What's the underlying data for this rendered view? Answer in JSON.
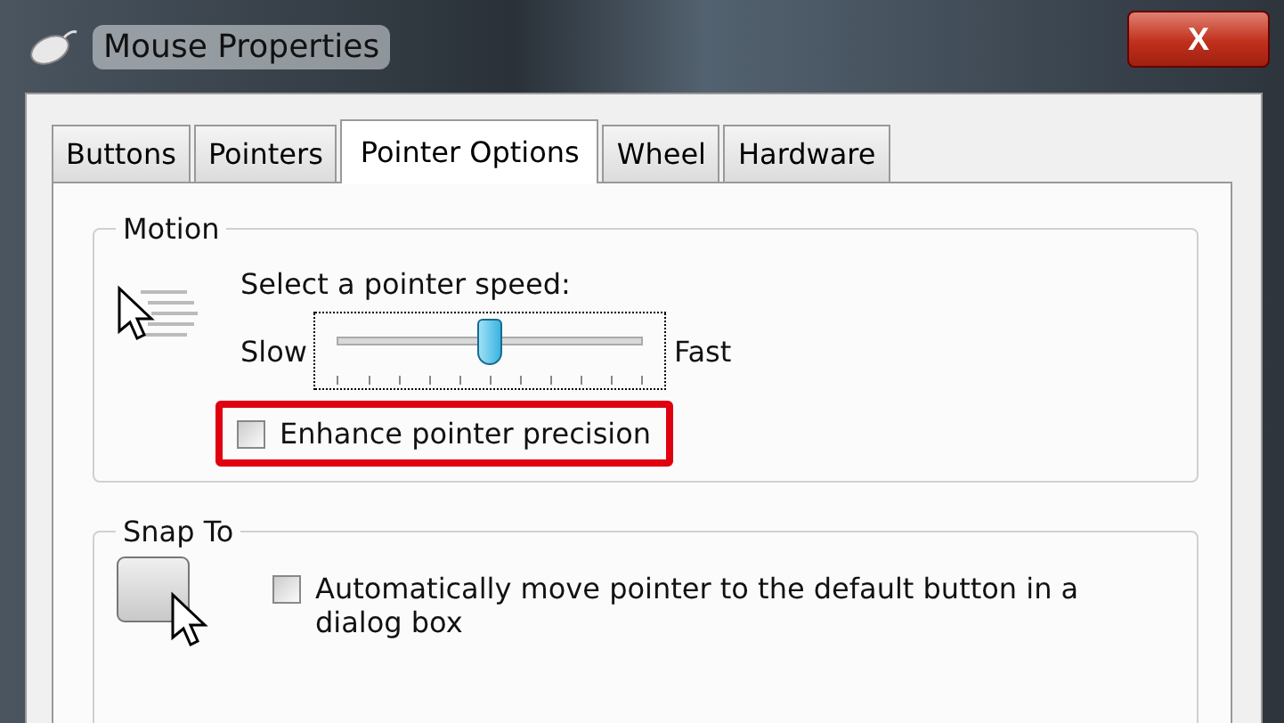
{
  "window": {
    "title": "Mouse Properties",
    "close": "X"
  },
  "tabs": [
    {
      "label": "Buttons",
      "selected": false
    },
    {
      "label": "Pointers",
      "selected": false
    },
    {
      "label": "Pointer Options",
      "selected": true
    },
    {
      "label": "Wheel",
      "selected": false
    },
    {
      "label": "Hardware",
      "selected": false
    }
  ],
  "motion": {
    "title": "Motion",
    "speed_label": "Select a pointer speed:",
    "slow_label": "Slow",
    "fast_label": "Fast",
    "speed": {
      "level": 0.5
    },
    "precision": {
      "label": "Enhance pointer precision",
      "checked": false,
      "highlighted": true
    }
  },
  "snap_to": {
    "title": "Snap To",
    "option": {
      "label": "Automatically move pointer to the default button in a dialog box",
      "checked": false,
      "highlighted": false
    }
  }
}
